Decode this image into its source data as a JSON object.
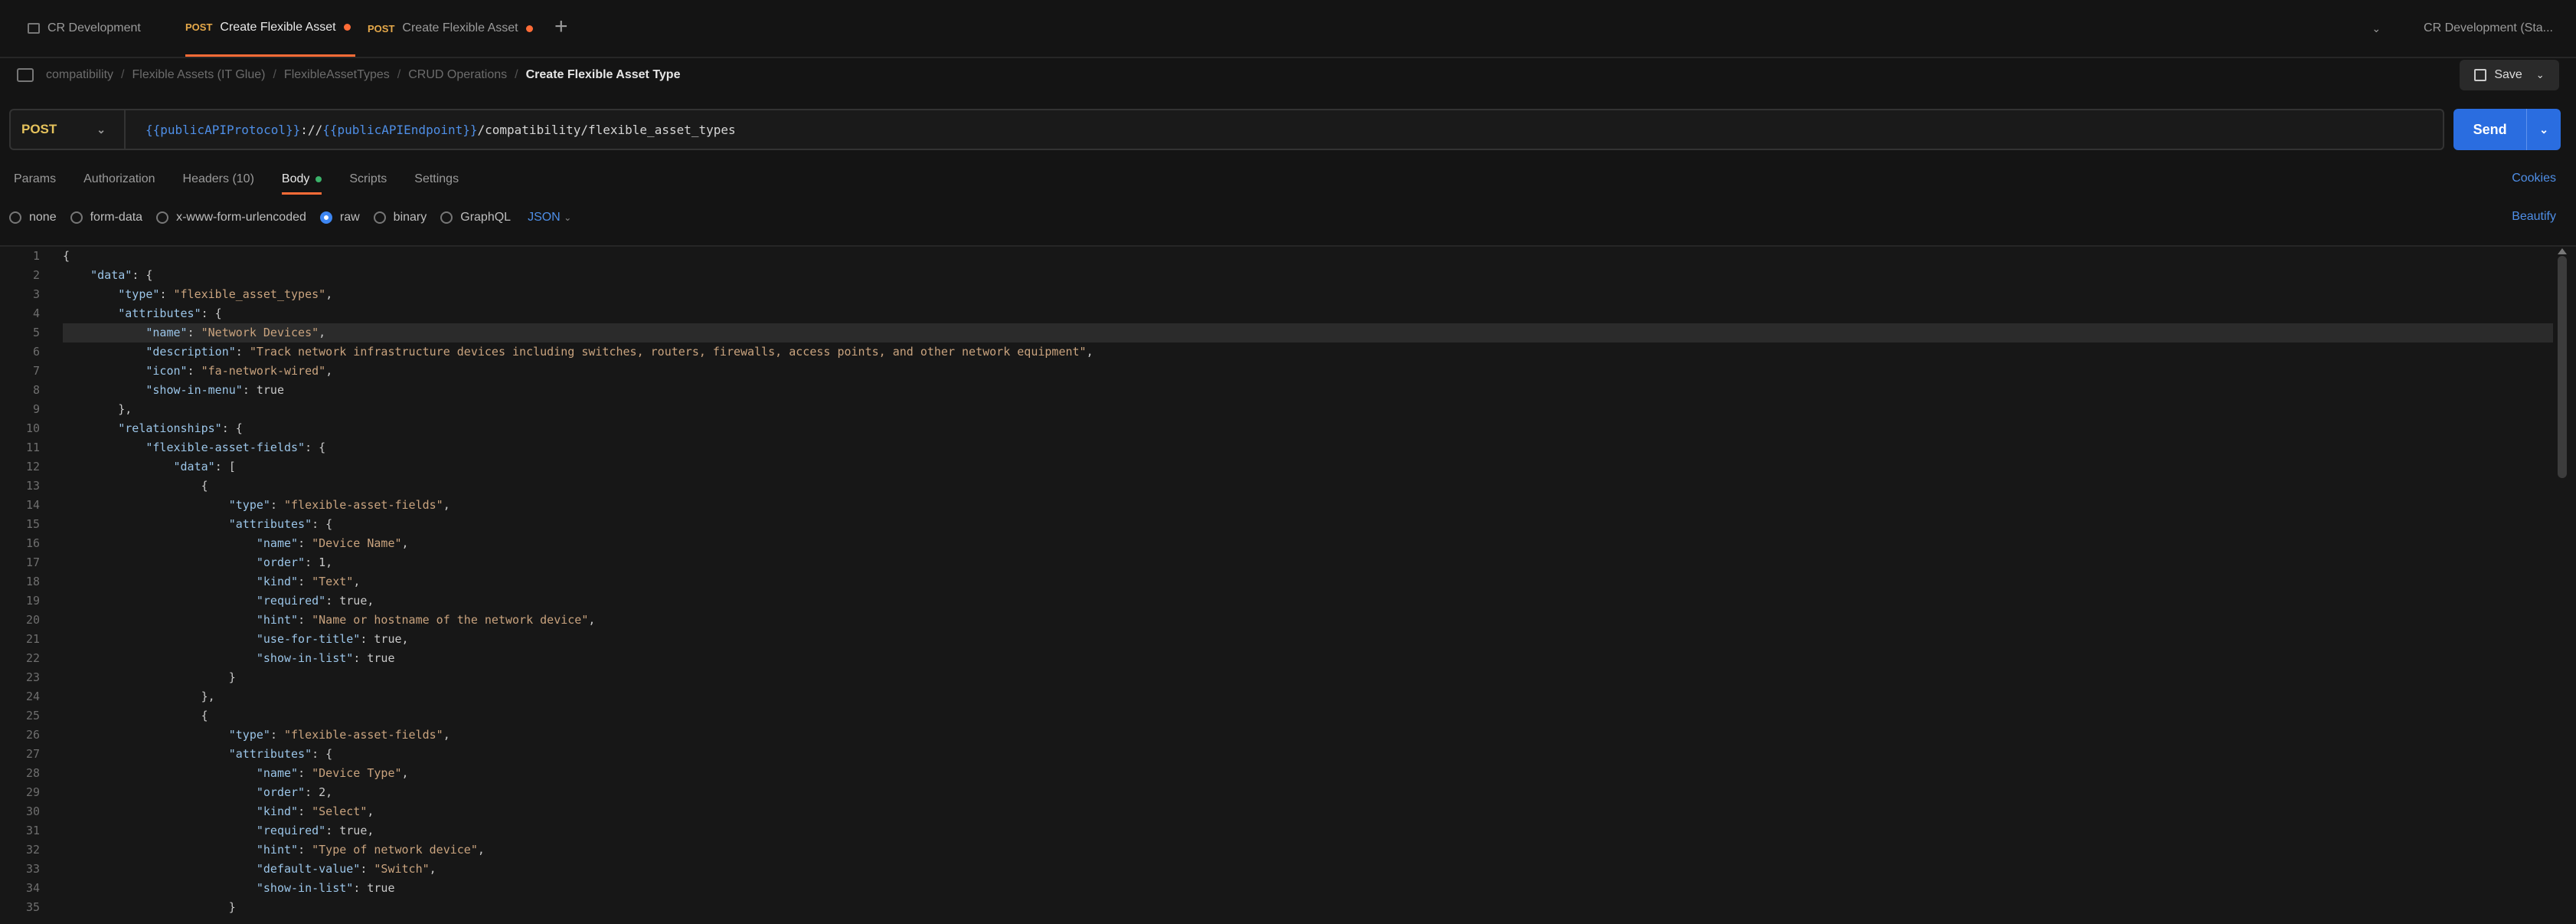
{
  "tabs": [
    {
      "label": "CR Development",
      "method": ""
    },
    {
      "label": "Create Flexible Asset",
      "method": "POST"
    },
    {
      "label": "Create Flexible Asset",
      "method": "POST"
    }
  ],
  "environment": "CR Development (Sta...",
  "breadcrumb": [
    "compatibility",
    "Flexible Assets (IT Glue)",
    "FlexibleAssetTypes",
    "CRUD Operations",
    "Create Flexible Asset Type"
  ],
  "save_label": "Save",
  "request": {
    "method": "POST",
    "url_var1": "{{publicAPIProtocol}}",
    "url_sep": " :// ",
    "url_var2": "{{publicAPIEndpoint}}",
    "url_path": " /compatibility/flexible_asset_types",
    "send_label": "Send"
  },
  "request_tabs": [
    "Params",
    "Authorization",
    "Headers (10)",
    "Body",
    "Scripts",
    "Settings"
  ],
  "cookies_label": "Cookies",
  "body_types": [
    "none",
    "form-data",
    "x-www-form-urlencoded",
    "raw",
    "binary",
    "GraphQL"
  ],
  "body_format": "JSON",
  "beautify_label": "Beautify",
  "code_lines": [
    "{",
    "    \"data\": {",
    "        \"type\": \"flexible_asset_types\",",
    "        \"attributes\": {",
    "            \"name\": \"Network Devices\",",
    "            \"description\": \"Track network infrastructure devices including switches, routers, firewalls, access points, and other network equipment\",",
    "            \"icon\": \"fa-network-wired\",",
    "            \"show-in-menu\": true",
    "        },",
    "        \"relationships\": {",
    "            \"flexible-asset-fields\": {",
    "                \"data\": [",
    "                    {",
    "                        \"type\": \"flexible-asset-fields\",",
    "                        \"attributes\": {",
    "                            \"name\": \"Device Name\",",
    "                            \"order\": 1,",
    "                            \"kind\": \"Text\",",
    "                            \"required\": true,",
    "                            \"hint\": \"Name or hostname of the network device\",",
    "                            \"use-for-title\": true,",
    "                            \"show-in-list\": true",
    "                        }",
    "                    },",
    "                    {",
    "                        \"type\": \"flexible-asset-fields\",",
    "                        \"attributes\": {",
    "                            \"name\": \"Device Type\",",
    "                            \"order\": 2,",
    "                            \"kind\": \"Select\",",
    "                            \"required\": true,",
    "                            \"hint\": \"Type of network device\",",
    "                            \"default-value\": \"Switch\",",
    "                            \"show-in-list\": true",
    "                        }"
  ]
}
